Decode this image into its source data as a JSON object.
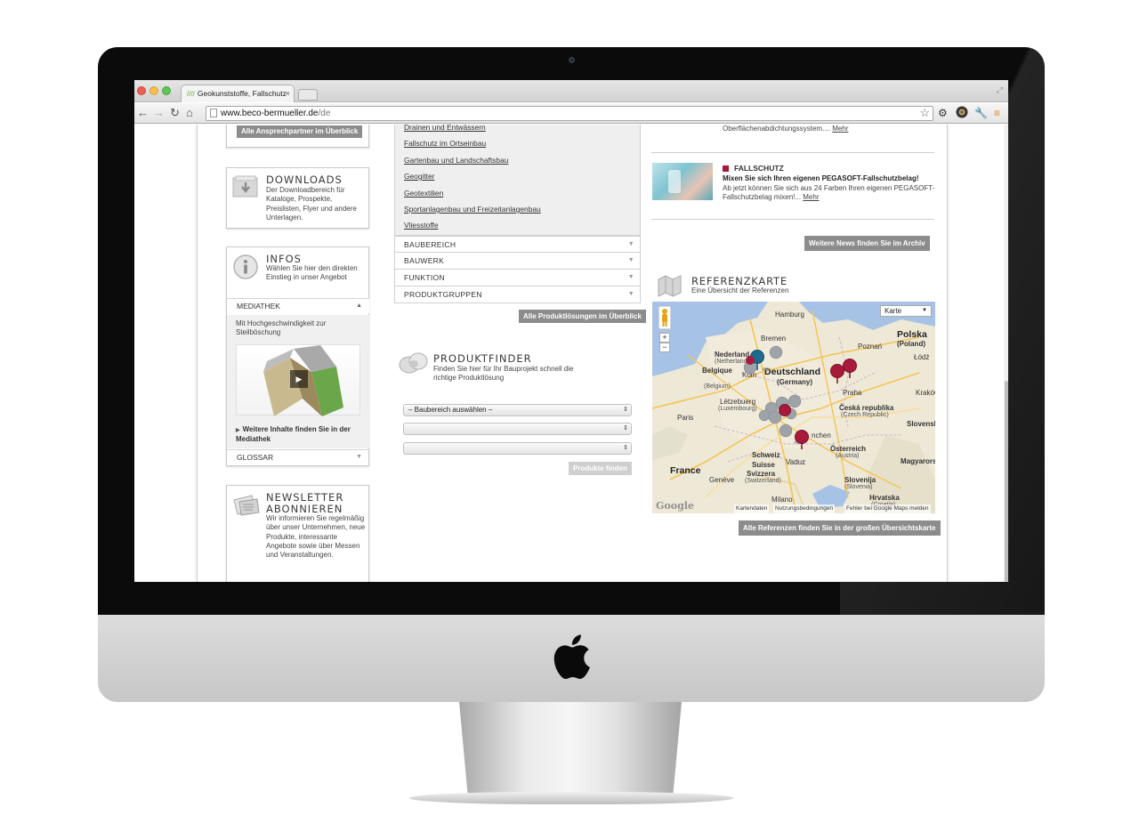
{
  "browser": {
    "tab_title": "Geokunststoffe, Fallschutz",
    "tab_favicon": "////",
    "tab_close": "×",
    "url_host": "www.beco-bermueller.de",
    "url_path": "/de",
    "icons": [
      "back-icon",
      "forward-icon",
      "reload-icon",
      "home-icon",
      "bookmark-star-icon",
      "settings-gear-icon",
      "extension-icon",
      "wrench-icon",
      "menu-icon"
    ]
  },
  "left": {
    "contact_button": "Alle Ansprechpartner im Überblick",
    "downloads": {
      "title": "DOWNLOADS",
      "text": "Der Downloadbereich für Kataloge, Prospekte, Preislisten, Flyer und andere Unterlagen."
    },
    "infos": {
      "title": "INFOS",
      "text": "Wählen Sie hier den direkten Einstieg in unser Angebot",
      "mediathek_label": "MEDIATHEK",
      "mediathek_caption": "Mit Hochgeschwindigkeit zur Steilböschung",
      "mediathek_more": "Weitere Inhalte finden Sie in der Mediathek",
      "glossar_label": "GLOSSAR"
    },
    "newsletter": {
      "title_line1": "NEWSLETTER",
      "title_line2": "ABONNIEREN",
      "text": "Wir informieren Sie regelmäßig über unser Unternehmen, neue Produkte, interessante Angebote sowie über Messen und Veranstaltungen."
    }
  },
  "middle": {
    "links": [
      "Drainen und Entwässern",
      "Fallschutz im Ortseinbau",
      "Gartenbau und Landschaftsbau",
      "Geogitter",
      "Geotextilien",
      "Sportanlagenbau und Freizeitanlagenbau",
      "Vliesstoffe"
    ],
    "filters": [
      "BAUBEREICH",
      "BAUWERK",
      "FUNKTION",
      "PRODUKTGRUPPEN"
    ],
    "all_solutions_button": "Alle Produktlösungen im Überblick",
    "produktfinder": {
      "title": "PRODUKTFINDER",
      "text": "Finden Sie hier für Ihr Bauprojekt schnell die richtige Produktlösung",
      "select1": "– Baubereich auswählen –",
      "select2": "",
      "select3": "",
      "find_button": "Produkte finden"
    }
  },
  "right": {
    "prev_news_tail": "Oberflächenabdichtungssystem.... ",
    "prev_news_more": "Mehr",
    "news": {
      "category": "FALLSCHUTZ",
      "headline": "Mixen Sie sich Ihren eigenen PEGASOFT-Fallschutzbelag!",
      "text": "Ab jetzt können Sie sich aus 24 Farben Ihren eigenen PEGASOFT-Fallschutzbelag mixen!... ",
      "more": "Mehr"
    },
    "archive_button": "Weitere News finden Sie im Archiv",
    "referenzkarte": {
      "title": "REFERENZKARTE",
      "subtitle": "Eine Übersicht der Referenzen",
      "map_type": "Karte",
      "zoom_in": "+",
      "zoom_out": "−",
      "labels": {
        "hamburg": "Hamburg",
        "bremen": "Bremen",
        "nederland": "Nederland",
        "netherlands": "(Netherlands)",
        "belgique": "Belgique",
        "belgium": "(Belgium)",
        "koln": "Köln",
        "deutschland": "Deutschland",
        "germany": "(Germany)",
        "polska": "Polska",
        "poland": "(Poland)",
        "poznan": "Poznań",
        "lodz": "Łódź",
        "krakow": "Kraków",
        "praha": "Praha",
        "cz1": "Česká republika",
        "cz2": "(Czech Republic)",
        "letzebuerg": "Lëtzebuerg",
        "luxembourg": "(Luxembourg)",
        "paris": "Paris",
        "munchen": "nchen",
        "osterreich": "Österreich",
        "austria": "(Austria)",
        "slovensko": "Slovensko",
        "magyarors": "Magyarors",
        "schweiz": "Schweiz",
        "suisse": "Suisse",
        "svizzera": "Svizzera",
        "switzerland": "(Switzerland)",
        "vaduz": "Vaduz",
        "france": "France",
        "geneve": "Genève",
        "milano": "Milano",
        "slovenija": "Slovenija",
        "slovenia": "(Slovenia)",
        "hrvatska": "Hrvatska",
        "croatia": "(Croatia)"
      },
      "footer_data": "Kartendaten",
      "footer_terms": "Nutzungsbedingungen",
      "footer_report": "Fehler bei Google Maps melden",
      "google_logo": "Google",
      "all_refs_button": "Alle Referenzen finden Sie in der großen Übersichtskarte"
    }
  }
}
